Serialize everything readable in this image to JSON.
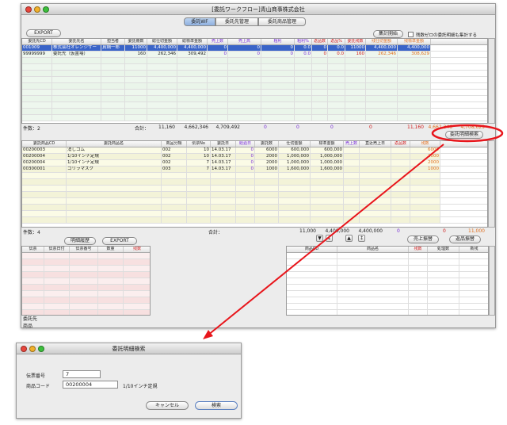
{
  "main": {
    "title": "[委託ワークフロー]青山商事株式会社",
    "tabs": [
      "委託WF",
      "委託先管理",
      "委託商品管理"
    ],
    "export_label": "EXPORT",
    "summary_start_label": "集計開始",
    "remaining_check_label": "残数ゼロの委託明細も集計する",
    "grid1": {
      "headers": [
        "委託先CD",
        "委託先名",
        "担当者",
        "委託冊数",
        "総仕切金額",
        "総標準金額",
        "売上数",
        "売上高",
        "粗利",
        "粗利%",
        "返品数",
        "返品%",
        "委託残数",
        "残仕切金額",
        "残標準金額"
      ],
      "rows": [
        [
          "001009",
          "株式会社オレンジサー",
          "真鍋一郎",
          "11000",
          "4,400,000",
          "4,400,000",
          "0",
          "0",
          "0",
          "0.0",
          "0",
          "0.0",
          "11000",
          "4,400,000",
          "4,400,000"
        ],
        [
          "99999999",
          "委託先（仮置場）",
          "",
          "160",
          "262,346",
          "309,492",
          "0",
          "0",
          "0",
          "0.0",
          "0",
          "0.0",
          "160",
          "262,346",
          "308,629"
        ]
      ],
      "footer": {
        "count_label": "件数：2",
        "total_label": "合計：",
        "total_count": "11,160",
        "total_shikiri": "4,662,346",
        "total_standard": "4,709,492",
        "sales": "0",
        "revenue": "0",
        "gross": "0",
        "returns": "0",
        "remain": "11,160",
        "remain_shikiri": "4,662,346",
        "remain_standard": "4,708,629"
      }
    },
    "detail_search_label": "委託明細検索",
    "grid2": {
      "headers": [
        "委託商品CD",
        "委託商品名",
        "商品分類",
        "伝票No",
        "委託日",
        "経過日",
        "委託数",
        "仕切金額",
        "標準金額",
        "売上数",
        "直近売上日",
        "返品数",
        "残数"
      ],
      "rows": [
        [
          "00200003",
          "消しゴム",
          "002",
          "10",
          "14.03.17",
          "0",
          "6000",
          "600,000",
          "600,000",
          "",
          "",
          "",
          "6000"
        ],
        [
          "00200004",
          "1/10インチ定規",
          "002",
          "10",
          "14.03.17",
          "0",
          "2000",
          "1,000,000",
          "1,000,000",
          "",
          "",
          "",
          "2000"
        ],
        [
          "00200004",
          "1/10インチ定規",
          "002",
          "7",
          "14.03.17",
          "0",
          "2000",
          "1,000,000",
          "1,000,000",
          "",
          "",
          "",
          "2000"
        ],
        [
          "00300001",
          "ゴリラマスク",
          "003",
          "7",
          "14.03.17",
          "0",
          "1000",
          "1,600,000",
          "1,600,000",
          "",
          "",
          "",
          "1000"
        ]
      ],
      "footer": {
        "count_label": "件数：4",
        "total_label": "合計：",
        "qty": "11,000",
        "shikiri": "4,400,000",
        "standard": "4,400,000",
        "sales": "0",
        "returns": "0",
        "remain": "11,000"
      }
    },
    "history_label": "明細履歴",
    "export2_label": "EXPORT",
    "grid3": {
      "headers": [
        "伝票",
        "伝票日付",
        "伝票番号",
        "数量",
        "残数"
      ]
    },
    "sales_transfer_label": "売上振替",
    "return_transfer_label": "返品振替",
    "grid4": {
      "headers": [
        "商品CD",
        "商品名",
        "残数",
        "処理数",
        "新残"
      ]
    },
    "partner_label": "委託先",
    "product_label": "商品"
  },
  "dialog": {
    "title": "委託明細検索",
    "slip_label": "伝票番号",
    "slip_value": "7",
    "code_label": "商品コード",
    "code_value": "00200004",
    "product_name": "1/10インチ定規",
    "cancel_label": "キャンセル",
    "search_label": "検索"
  },
  "colors": {
    "accent": "#3a64c8",
    "highlight": "#e8151b",
    "purple": "#7a2fd6"
  }
}
